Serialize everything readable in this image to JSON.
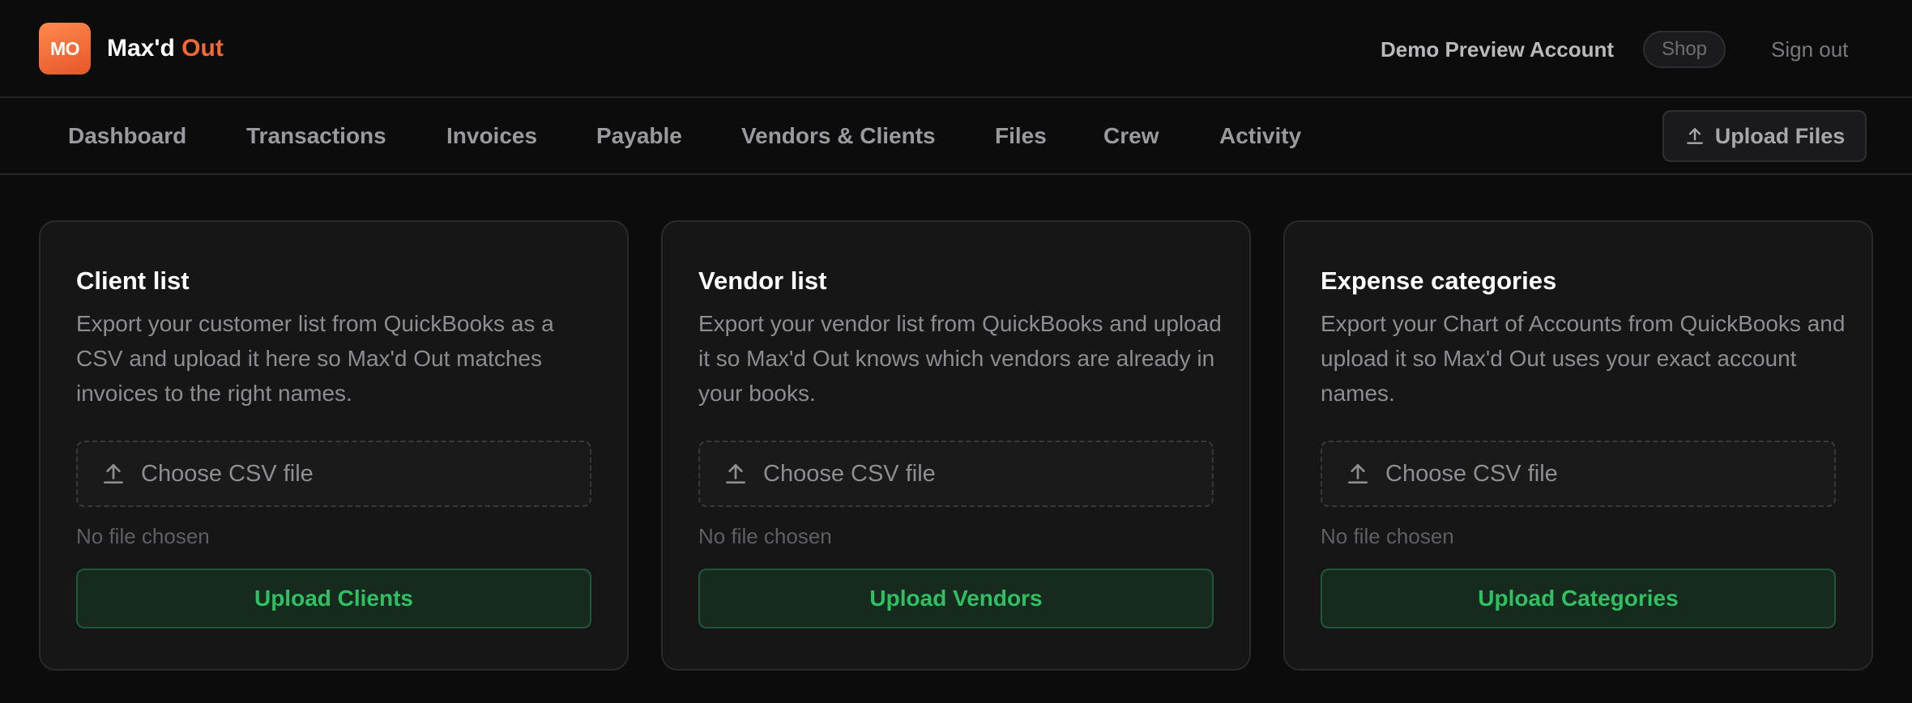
{
  "header": {
    "logo_initials": "MO",
    "brand_primary": "Max'd",
    "brand_accent": "Out",
    "account_name": "Demo Preview Account",
    "shop_label": "Shop",
    "sign_out_label": "Sign out"
  },
  "nav": {
    "items": [
      {
        "label": "Dashboard"
      },
      {
        "label": "Transactions"
      },
      {
        "label": "Invoices"
      },
      {
        "label": "Payable"
      },
      {
        "label": "Vendors & Clients"
      },
      {
        "label": "Files"
      },
      {
        "label": "Crew"
      },
      {
        "label": "Activity"
      }
    ],
    "upload_files_label": "Upload Files"
  },
  "cards": [
    {
      "title": "Client list",
      "description": "Export your customer list from QuickBooks as a CSV and upload it here so Max'd Out matches invoices to the right names.",
      "choose_label": "Choose CSV file",
      "file_status": "No file chosen",
      "upload_label": "Upload Clients"
    },
    {
      "title": "Vendor list",
      "description": "Export your vendor list from QuickBooks and upload it so Max'd Out knows which vendors are already in your books.",
      "choose_label": "Choose CSV file",
      "file_status": "No file chosen",
      "upload_label": "Upload Vendors"
    },
    {
      "title": "Expense categories",
      "description": "Export your Chart of Accounts from QuickBooks and upload it so Max'd Out uses your exact account names.",
      "choose_label": "Choose CSV file",
      "file_status": "No file chosen",
      "upload_label": "Upload Categories"
    }
  ],
  "icons": {
    "upload": "upload-icon"
  },
  "colors": {
    "background": "#0c0c0d",
    "card": "#161617",
    "brand_accent": "#f06a35",
    "success_text": "#2ec063",
    "success_bg": "#172a1e"
  }
}
